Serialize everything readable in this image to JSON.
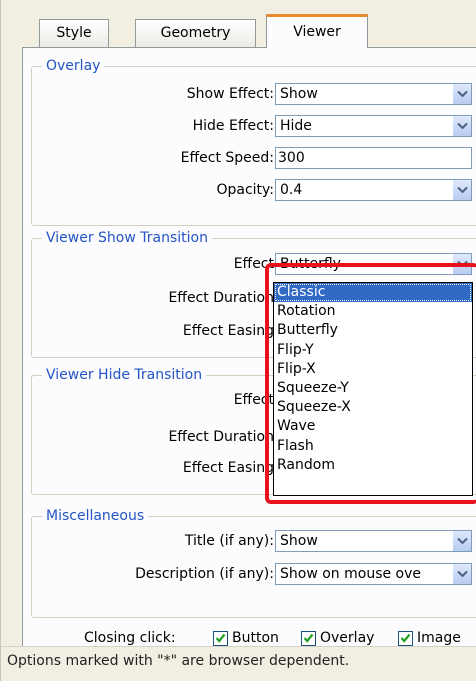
{
  "tabs": [
    {
      "label": "Style",
      "active": false
    },
    {
      "label": "Geometry",
      "active": false
    },
    {
      "label": "Viewer",
      "active": true
    }
  ],
  "overlay": {
    "legend": "Overlay",
    "show_effect": {
      "label": "Show Effect:",
      "value": "Show"
    },
    "hide_effect": {
      "label": "Hide Effect:",
      "value": "Hide"
    },
    "effect_speed": {
      "label": "Effect Speed:",
      "value": "300"
    },
    "opacity": {
      "label": "Opacity:",
      "value": "0.4"
    }
  },
  "show_transition": {
    "legend": "Viewer Show Transition",
    "effect": {
      "label": "Effect",
      "value": "Butterfly"
    },
    "effect_duration": {
      "label": "Effect Duration"
    },
    "effect_easing": {
      "label": "Effect Easing"
    }
  },
  "hide_transition": {
    "legend": "Viewer Hide Transition",
    "effect": {
      "label": "Effect"
    },
    "effect_duration": {
      "label": "Effect Duration"
    },
    "effect_easing": {
      "label": "Effect Easing"
    }
  },
  "dropdown": {
    "options": [
      "Classic",
      "Rotation",
      "Butterfly",
      "Flip-Y",
      "Flip-X",
      "Squeeze-Y",
      "Squeeze-X",
      "Wave",
      "Flash",
      "Random"
    ],
    "highlighted": "Classic"
  },
  "misc": {
    "legend": "Miscellaneous",
    "title": {
      "label": "Title (if any):",
      "value": "Show"
    },
    "description": {
      "label": "Description (if any):",
      "value": "Show on mouse ove"
    }
  },
  "closing": {
    "label": "Closing click:",
    "options": [
      {
        "label": "Button",
        "checked": true
      },
      {
        "label": "Overlay",
        "checked": true
      },
      {
        "label": "Image",
        "checked": true
      }
    ]
  },
  "footer": "Options marked with \"*\" are browser dependent.",
  "colors": {
    "accent": "#2455c4",
    "highlight_border": "#e8121b",
    "selected_option": "#316ac5",
    "active_tab_top": "#e68b2c"
  },
  "icons": [
    "chevron-down-icon",
    "checkmark-icon"
  ]
}
